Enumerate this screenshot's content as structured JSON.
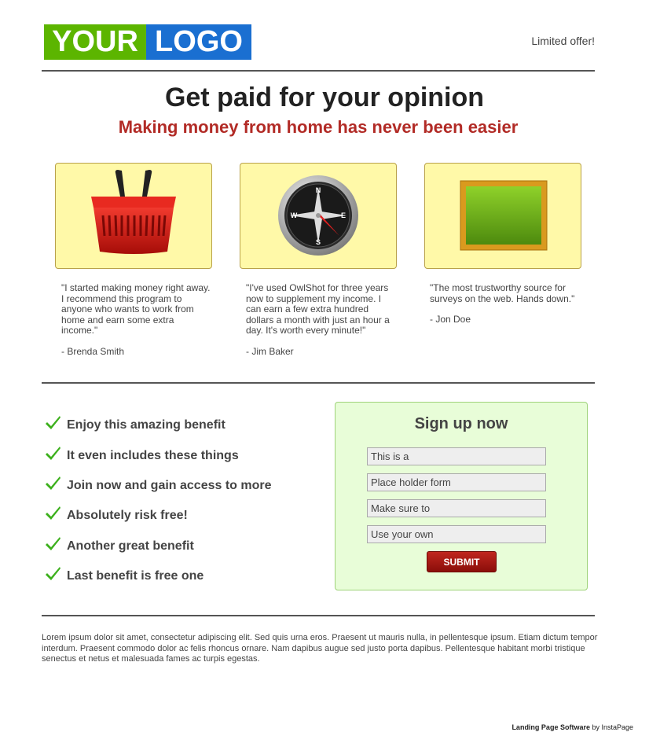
{
  "header": {
    "logo_left": "YOUR",
    "logo_right": "LOGO",
    "offer": "Limited offer!"
  },
  "hero": {
    "headline": "Get paid for your opinion",
    "subheadline": "Making money from home has never been easier"
  },
  "features": [
    {
      "icon": "basket-icon",
      "quote": "\"I started making money right away.  I recommend this program to anyone who wants to work from home and earn some extra income.\"",
      "author": "- Brenda Smith"
    },
    {
      "icon": "compass-icon",
      "quote": "\"I've used OwlShot for three years now to supplement my income.  I can earn a few extra hundred dollars a month with just an hour a day.  It's worth every minute!\"",
      "author": "- Jim Baker"
    },
    {
      "icon": "chalkboard-icon",
      "quote": "\"The most trustworthy source for surveys on the web.  Hands down.\"",
      "author": "- Jon Doe"
    }
  ],
  "benefits": [
    "Enjoy this amazing benefit",
    "It even includes these things",
    "Join now and gain access to more",
    "Absolutely risk free!",
    "Another great benefit",
    "Last benefit is free one"
  ],
  "form": {
    "title": "Sign up now",
    "fields": [
      "This is a",
      "Place holder form",
      "Make sure to",
      "Use your own"
    ],
    "submit": "SUBMIT"
  },
  "footer": {
    "lorem": "Lorem ipsum dolor sit amet, consectetur adipiscing elit. Sed quis urna eros. Praesent ut mauris nulla, in pellentesque ipsum. Etiam dictum tempor interdum. Praesent commodo dolor ac felis rhoncus ornare. Nam dapibus augue sed justo porta dapibus. Pellentesque habitant morbi tristique senectus et netus et malesuada fames ac turpis egestas.",
    "credit_bold": "Landing Page Software",
    "credit_rest": " by InstaPage"
  },
  "colors": {
    "logo_green": "#5cb500",
    "logo_blue": "#1a6fd1",
    "subhead_red": "#b22b26",
    "card_yellow": "#fff9a8",
    "form_green": "#e8fdd8",
    "submit_red": "#a81a14"
  }
}
